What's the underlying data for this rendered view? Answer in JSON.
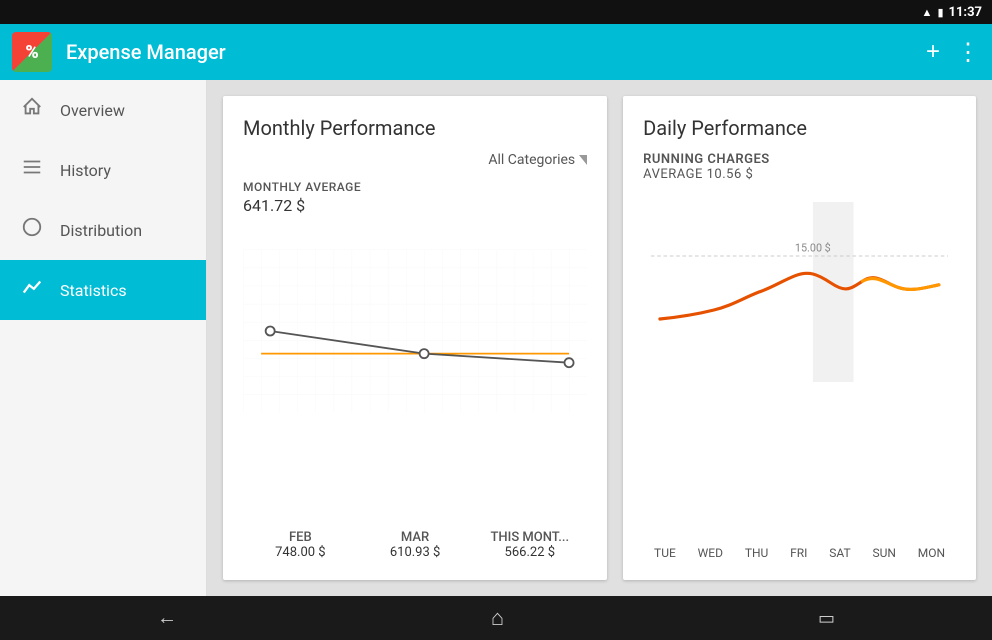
{
  "statusBar": {
    "time": "11:37",
    "wifiIcon": "📶",
    "batteryIcon": "🔋"
  },
  "appBar": {
    "title": "Expense Manager",
    "logoSymbol": "%",
    "addIcon": "+",
    "moreIcon": "⋮"
  },
  "sidebar": {
    "items": [
      {
        "id": "overview",
        "label": "Overview",
        "icon": "🏠",
        "active": false
      },
      {
        "id": "history",
        "label": "History",
        "icon": "☰",
        "active": false
      },
      {
        "id": "distribution",
        "label": "Distribution",
        "icon": "◯",
        "active": false
      },
      {
        "id": "statistics",
        "label": "Statistics",
        "icon": "📈",
        "active": true
      }
    ]
  },
  "monthlyCard": {
    "title": "Monthly Performance",
    "categoryFilter": "All Categories",
    "avgLabel": "MONTHLY AVERAGE",
    "avgValue": "641.72 $",
    "months": [
      {
        "name": "FEB",
        "value": "748.00 $"
      },
      {
        "name": "MAR",
        "value": "610.93 $"
      },
      {
        "name": "THIS MONT...",
        "value": "566.22 $"
      }
    ]
  },
  "dailyCard": {
    "title": "Daily Performance",
    "runningLabel": "RUNNING CHARGES",
    "avgLabel": "AVERAGE 10.56 $",
    "chartLabel": "15.00 $",
    "days": [
      "TUE",
      "WED",
      "THU",
      "FRI",
      "SAT",
      "SUN",
      "MON"
    ]
  },
  "navBar": {
    "backIcon": "←",
    "homeIcon": "⌂",
    "recentsIcon": "▭"
  }
}
